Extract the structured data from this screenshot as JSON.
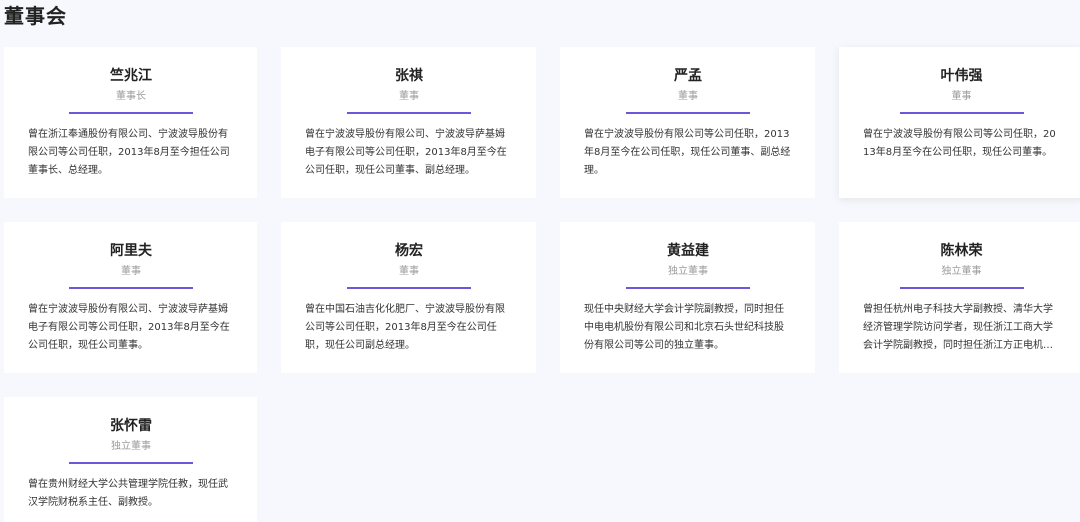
{
  "page": {
    "title": "董事会"
  },
  "members": [
    {
      "name": "竺兆江",
      "role": "董事长",
      "desc": "曾在浙江奉通股份有限公司、宁波波导股份有限公司等公司任职，2013年8月至今担任公司董事长、总经理。"
    },
    {
      "name": "张祺",
      "role": "董事",
      "desc": "曾在宁波波导股份有限公司、宁波波导萨基姆电子有限公司等公司任职，2013年8月至今在公司任职，现任公司董事、副总经理。"
    },
    {
      "name": "严孟",
      "role": "董事",
      "desc": "曾在宁波波导股份有限公司等公司任职，2013年8月至今在公司任职，现任公司董事、副总经理。"
    },
    {
      "name": "叶伟强",
      "role": "董事",
      "desc": "曾在宁波波导股份有限公司等公司任职，2013年8月至今在公司任职，现任公司董事。"
    },
    {
      "name": "阿里夫",
      "role": "董事",
      "desc": "曾在宁波波导股份有限公司、宁波波导萨基姆电子有限公司等公司任职，2013年8月至今在公司任职，现任公司董事。"
    },
    {
      "name": "杨宏",
      "role": "董事",
      "desc": "曾在中国石油吉化化肥厂、宁波波导股份有限公司等公司任职，2013年8月至今在公司任职，现任公司副总经理。"
    },
    {
      "name": "黄益建",
      "role": "独立董事",
      "desc": "现任中央财经大学会计学院副教授，同时担任中电电机股份有限公司和北京石头世纪科技股份有限公司等公司的独立董事。"
    },
    {
      "name": "陈林荣",
      "role": "独立董事",
      "desc": "曾担任杭州电子科技大学副教授、清华大学经济管理学院访问学者，现任浙江工商大学会计学院副教授，同时担任浙江方正电机股份有…"
    },
    {
      "name": "张怀雷",
      "role": "独立董事",
      "desc": "曾在贵州财经大学公共管理学院任教，现任武汉学院财税系主任、副教授。"
    }
  ],
  "colors": {
    "accent": "#6b57d9",
    "background": "#f6f8fd"
  }
}
